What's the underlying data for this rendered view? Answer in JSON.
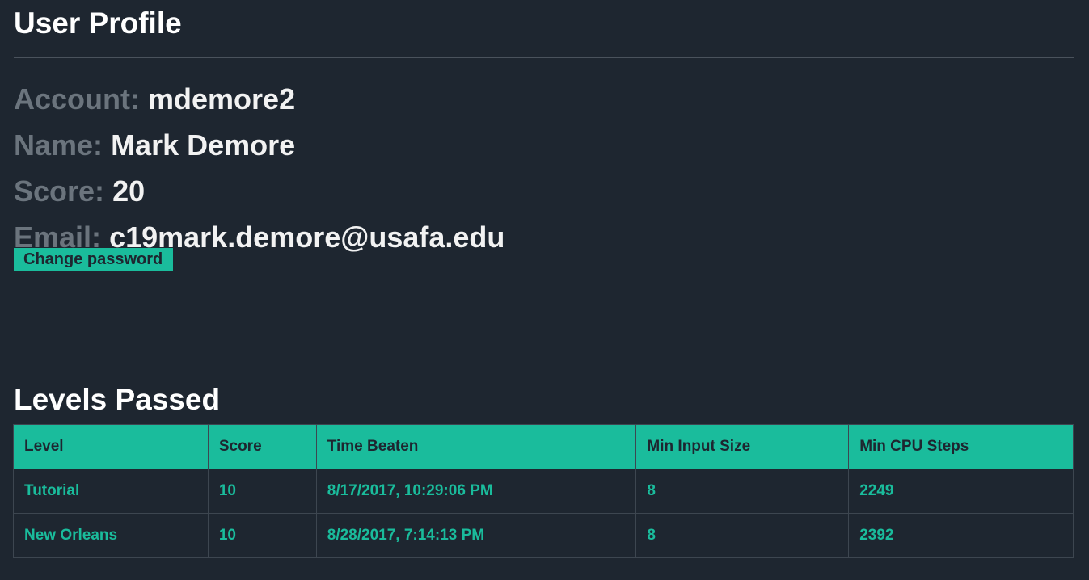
{
  "header": {
    "title": "User Profile"
  },
  "profile": {
    "account_label": "Account:",
    "account_value": "mdemore2",
    "name_label": "Name:",
    "name_value": "Mark Demore",
    "score_label": "Score:",
    "score_value": "20",
    "email_label": "Email:",
    "email_value": "c19mark.demore@usafa.edu",
    "change_password_label": "Change password"
  },
  "levels": {
    "title": "Levels Passed",
    "columns": [
      "Level",
      "Score",
      "Time Beaten",
      "Min Input Size",
      "Min CPU Steps"
    ],
    "rows": [
      [
        "Tutorial",
        "10",
        "8/17/2017, 10:29:06 PM",
        "8",
        "2249"
      ],
      [
        "New Orleans",
        "10",
        "8/28/2017, 7:14:13 PM",
        "8",
        "2392"
      ]
    ]
  },
  "colors": {
    "background": "#1e2630",
    "accent": "#1abc9c",
    "muted_label": "#6b747d"
  }
}
